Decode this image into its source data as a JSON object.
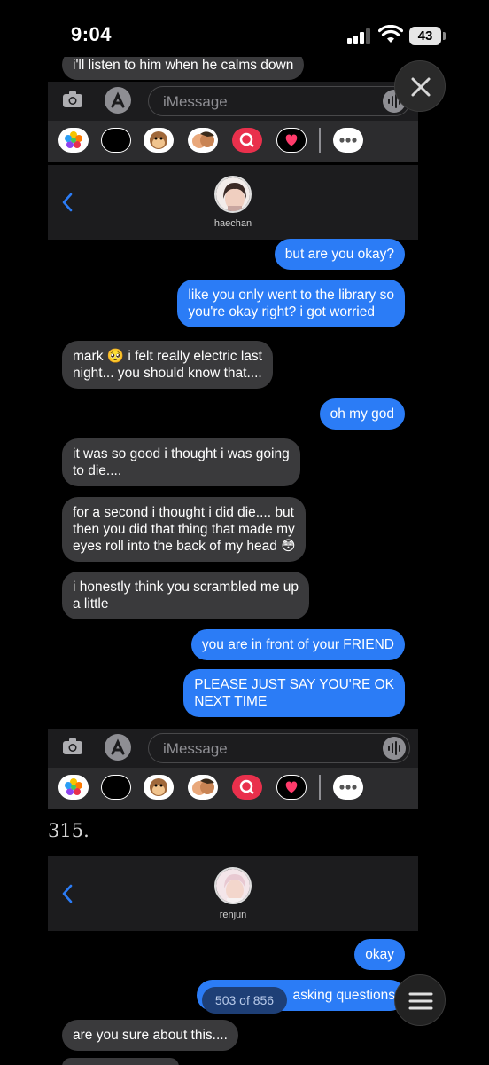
{
  "status_bar": {
    "time": "9:04",
    "battery": "43"
  },
  "screenshot1": {
    "top_partial_message": "i'll listen to him when he calms down",
    "input_placeholder": "iMessage"
  },
  "screenshot2": {
    "contact_name": "haechan",
    "messages": [
      {
        "from": "me",
        "text": "but are you okay?"
      },
      {
        "from": "me",
        "text": "like you only went to the library so\nyou're okay right? i got worried"
      },
      {
        "from": "them",
        "text": "mark 🥺 i felt really electric last\nnight... you should know that...."
      },
      {
        "from": "me",
        "text": "oh my god"
      },
      {
        "from": "them",
        "text": "it was so good i thought i was going\nto die...."
      },
      {
        "from": "them",
        "text": "for a second i thought i did die.... but\nthen you did that thing that made my\neyes roll into the back of my head 😳"
      },
      {
        "from": "them",
        "text": "i honestly think you scrambled me up\na little"
      },
      {
        "from": "me",
        "text": "you are in front of your FRIEND"
      },
      {
        "from": "me",
        "text": "PLEASE JUST SAY YOU'RE OK\nNEXT TIME"
      }
    ],
    "input_placeholder": "iMessage"
  },
  "chapter_label": "315.",
  "screenshot3": {
    "contact_name": "renjun",
    "messages": [
      {
        "from": "me",
        "text": "okay"
      },
      {
        "from": "me",
        "text": "asking questions"
      },
      {
        "from": "them",
        "text": "are you sure about this...."
      }
    ]
  },
  "page_counter": "503 of 856",
  "colors": {
    "sent_bubble": "#2b7cf6",
    "received_bubble": "#3a3a3c",
    "background": "#000000"
  }
}
